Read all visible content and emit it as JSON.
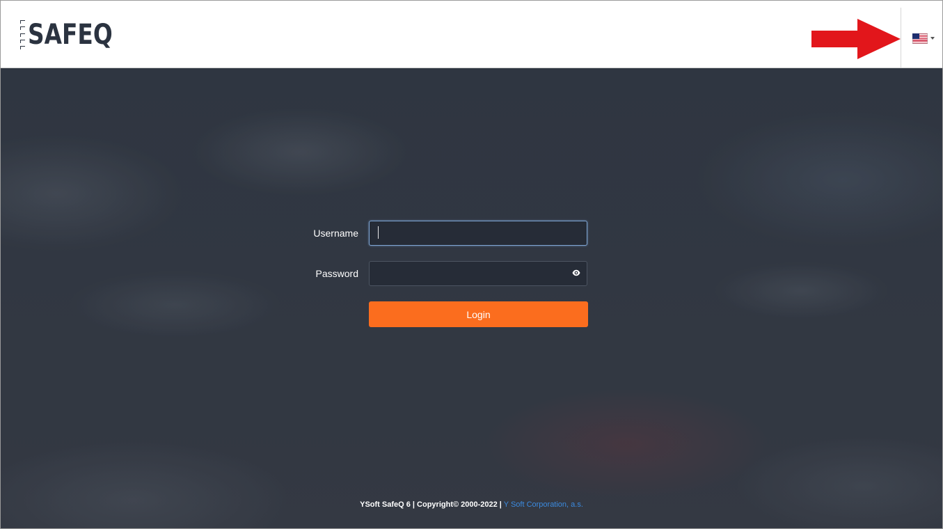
{
  "header": {
    "logo_text": "SAFEQ",
    "language": {
      "current": "English (US)",
      "flag_icon": "us-flag-icon"
    },
    "annotation_arrow_color": "#e2161b"
  },
  "login_form": {
    "username_label": "Username",
    "username_value": "",
    "password_label": "Password",
    "password_value": "",
    "show_password_icon": "eye-icon",
    "login_button_label": "Login"
  },
  "footer": {
    "product": "YSoft SafeQ 6 | Copyright© 2000-2022 |",
    "company_link": " Y Soft Corporation, a.s."
  },
  "colors": {
    "accent": "#fb6d1e",
    "background": "#363c48",
    "link": "#3c8be0",
    "logo": "#2b3340"
  }
}
